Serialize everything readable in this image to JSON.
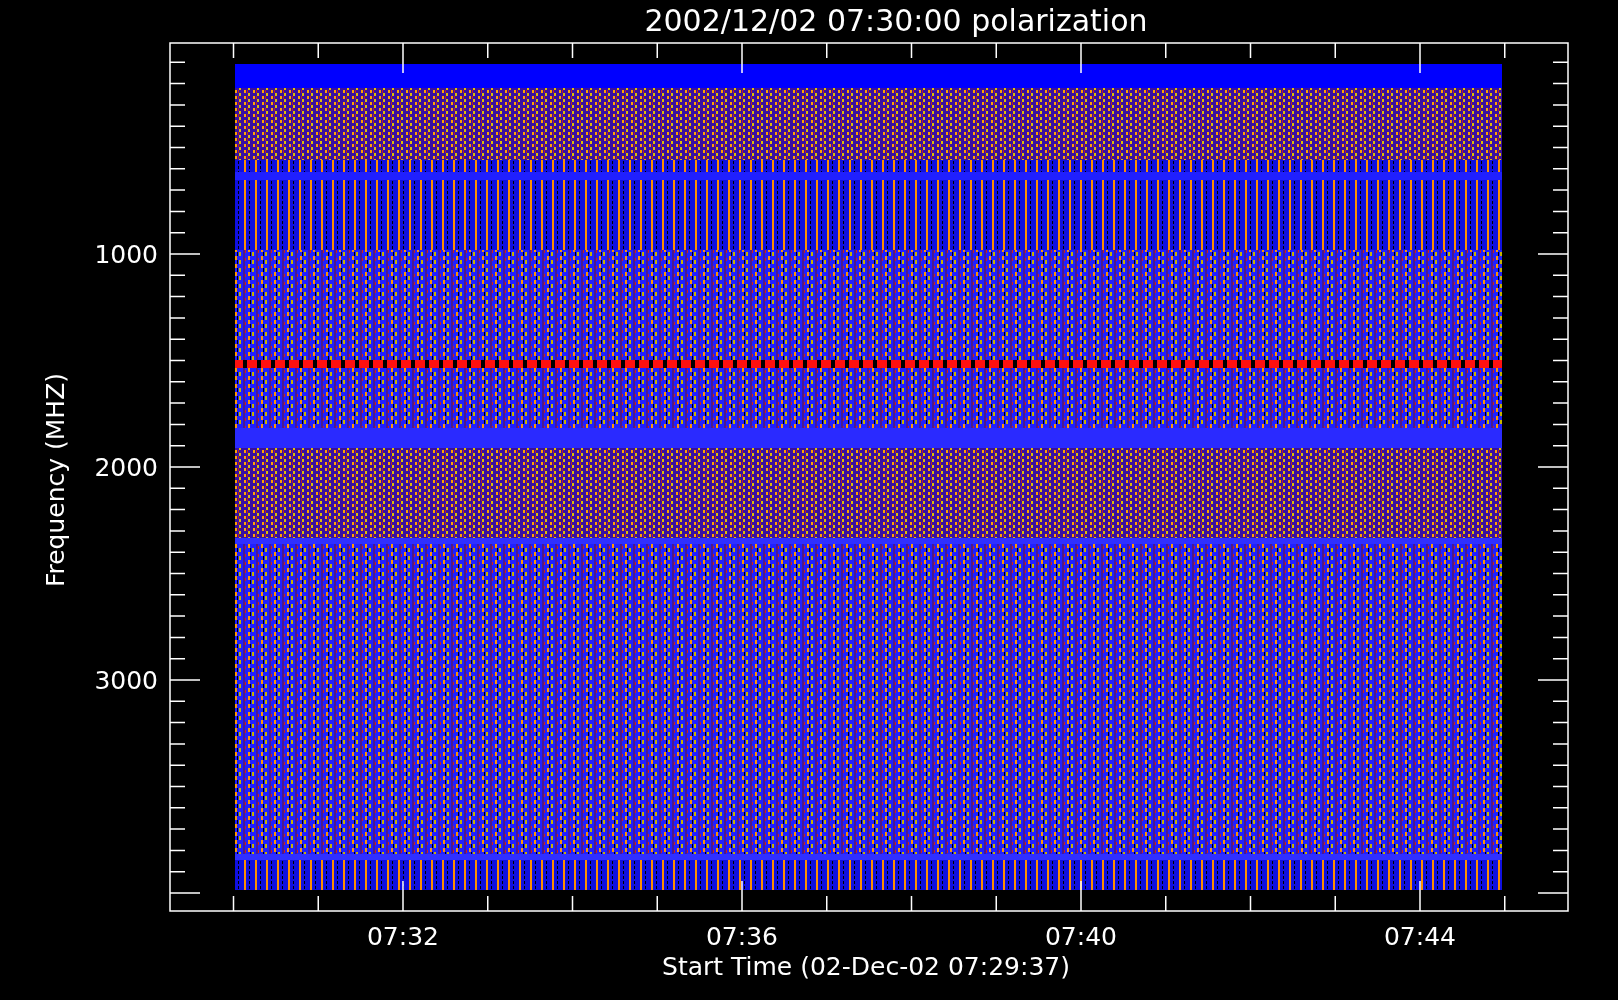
{
  "title": "2002/12/02 07:30:00 polarization",
  "y_axis": {
    "label": "Frequency (MHZ)",
    "ticks": [
      "1000",
      "2000",
      "3000"
    ]
  },
  "x_axis": {
    "label": "Start Time (02-Dec-02 07:29:37)",
    "ticks": [
      "07:32",
      "07:36",
      "07:40",
      "07:44"
    ]
  }
}
